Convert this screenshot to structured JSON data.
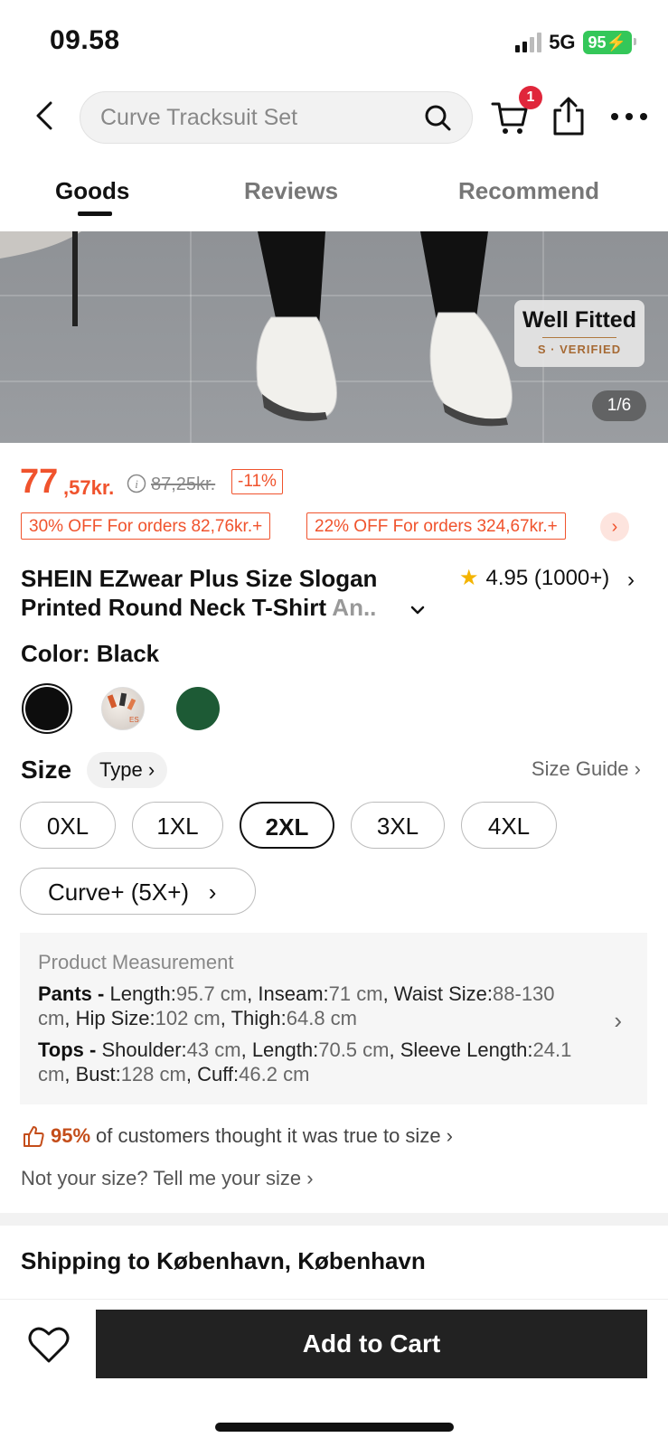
{
  "status": {
    "time": "09.58",
    "network": "5G",
    "battery": "95"
  },
  "header": {
    "search_placeholder": "Curve Tracksuit Set",
    "cart_count": "1"
  },
  "tabs": [
    {
      "label": "Goods",
      "active": true
    },
    {
      "label": "Reviews",
      "active": false
    },
    {
      "label": "Recommend",
      "active": false
    }
  ],
  "gallery": {
    "badge_title": "Well Fitted",
    "badge_sub": "S · VERIFIED",
    "counter": "1/6"
  },
  "price": {
    "whole": "77",
    "decimal": ",57kr.",
    "original": "87,25kr.",
    "discount": "-11%"
  },
  "coupons": [
    "30% OFF For orders 82,76kr.+",
    "22% OFF For orders 324,67kr.+"
  ],
  "product": {
    "title_line1": "SHEIN EZwear Plus Size Slogan",
    "title_line2": "Printed Round Neck T-Shirt ",
    "title_fade": "An..",
    "rating": "4.95 (1000+)"
  },
  "color": {
    "label": "Color: Black",
    "swatches": [
      {
        "name": "Black",
        "hex": "#0d0d0d"
      },
      {
        "name": "Print",
        "hex": "#e8e2de"
      },
      {
        "name": "Green",
        "hex": "#1d5a35"
      }
    ]
  },
  "size": {
    "label": "Size",
    "type_label": "Type",
    "guide_label": "Size Guide",
    "options": [
      "0XL",
      "1XL",
      "2XL",
      "3XL",
      "4XL"
    ],
    "selected": "2XL",
    "curve_label": "Curve+ (5X+)"
  },
  "measurement": {
    "title": "Product Measurement",
    "pants_label": "Pants - ",
    "pants": [
      {
        "k": "Length:",
        "v": "95.7 cm"
      },
      {
        "k": "Inseam:",
        "v": "71 cm"
      },
      {
        "k": "Waist Size:",
        "v": "88-130 cm"
      },
      {
        "k": "Hip Size:",
        "v": "102 cm"
      },
      {
        "k": "Thigh:",
        "v": "64.8 cm"
      }
    ],
    "tops_label": "Tops - ",
    "tops": [
      {
        "k": "Shoulder:",
        "v": "43 cm"
      },
      {
        "k": "Length:",
        "v": "70.5 cm"
      },
      {
        "k": "Sleeve Length:",
        "v": "24.1 cm"
      },
      {
        "k": "Bust:",
        "v": "128 cm"
      },
      {
        "k": "Cuff:",
        "v": "46.2 cm"
      }
    ]
  },
  "fit": {
    "percent": "95%",
    "text": "of customers thought it was true to size",
    "not_size": "Not your size? Tell me your size"
  },
  "shipping": {
    "label": "Shipping to København, København"
  },
  "actions": {
    "add_to_cart": "Add to Cart"
  },
  "colors": {
    "accent": "#f0532d",
    "badge": "#e0263b",
    "button": "#222222"
  }
}
